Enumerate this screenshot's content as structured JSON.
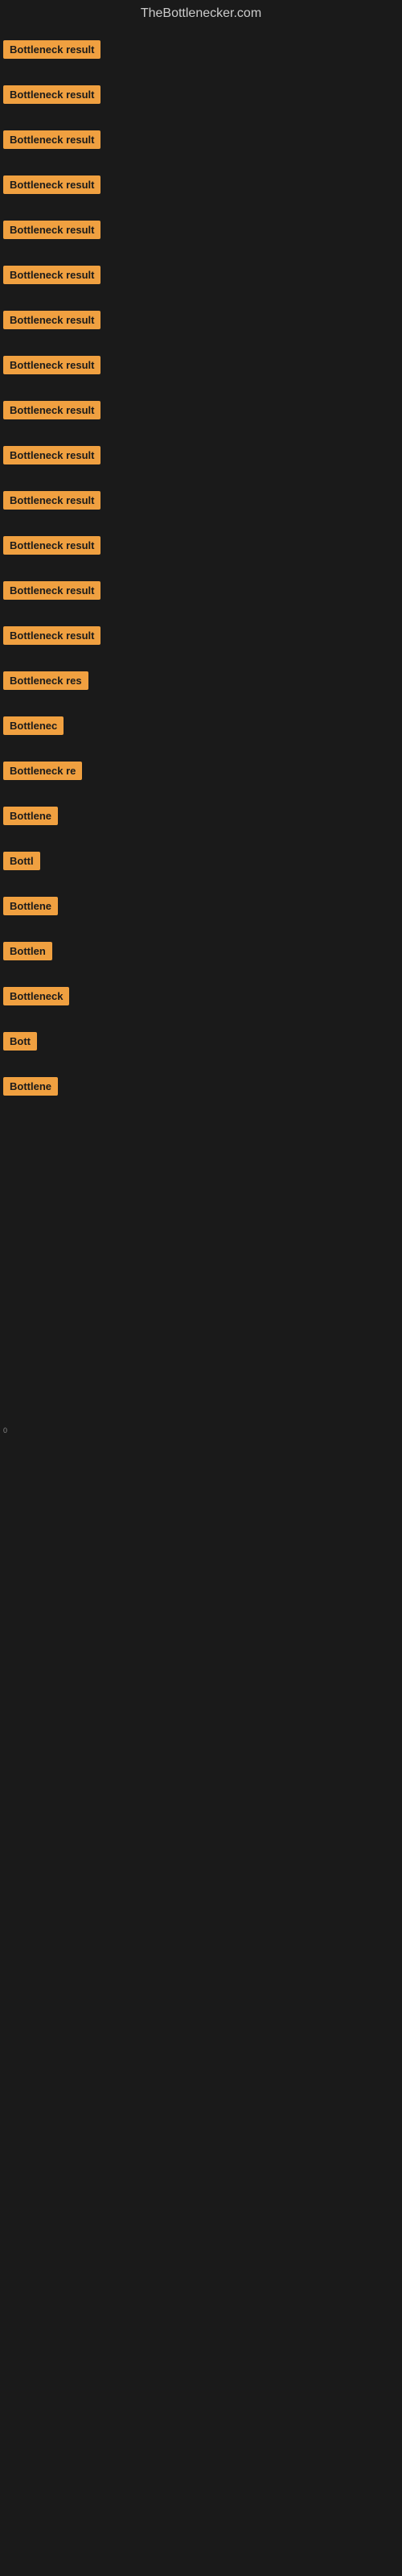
{
  "header": {
    "title": "TheBottlenecker.com"
  },
  "bottleneck_items": [
    {
      "label": "Bottleneck result",
      "size_class": "item-full",
      "row_spacing": 30
    },
    {
      "label": "Bottleneck result",
      "size_class": "item-full",
      "row_spacing": 30
    },
    {
      "label": "Bottleneck result",
      "size_class": "item-full",
      "row_spacing": 30
    },
    {
      "label": "Bottleneck result",
      "size_class": "item-full",
      "row_spacing": 30
    },
    {
      "label": "Bottleneck result",
      "size_class": "item-full",
      "row_spacing": 30
    },
    {
      "label": "Bottleneck result",
      "size_class": "item-full",
      "row_spacing": 30
    },
    {
      "label": "Bottleneck result",
      "size_class": "item-full",
      "row_spacing": 30
    },
    {
      "label": "Bottleneck result",
      "size_class": "item-full",
      "row_spacing": 30
    },
    {
      "label": "Bottleneck result",
      "size_class": "item-full",
      "row_spacing": 30
    },
    {
      "label": "Bottleneck result",
      "size_class": "item-full",
      "row_spacing": 30
    },
    {
      "label": "Bottleneck result",
      "size_class": "item-full",
      "row_spacing": 30
    },
    {
      "label": "Bottleneck result",
      "size_class": "item-full",
      "row_spacing": 30
    },
    {
      "label": "Bottleneck result",
      "size_class": "item-full",
      "row_spacing": 30
    },
    {
      "label": "Bottleneck result",
      "size_class": "item-full",
      "row_spacing": 30
    },
    {
      "label": "Bottleneck res",
      "size_class": "item-w1",
      "row_spacing": 25
    },
    {
      "label": "Bottlenec",
      "size_class": "item-w2",
      "row_spacing": 25
    },
    {
      "label": "Bottleneck re",
      "size_class": "item-w1",
      "row_spacing": 25
    },
    {
      "label": "Bottlene",
      "size_class": "item-w3",
      "row_spacing": 25
    },
    {
      "label": "Bottl",
      "size_class": "item-w4",
      "row_spacing": 25
    },
    {
      "label": "Bottlene",
      "size_class": "item-w3",
      "row_spacing": 25
    },
    {
      "label": "Bottlen",
      "size_class": "item-w4",
      "row_spacing": 25
    },
    {
      "label": "Bottleneck",
      "size_class": "item-w2",
      "row_spacing": 25
    },
    {
      "label": "Bott",
      "size_class": "item-w5",
      "row_spacing": 25
    },
    {
      "label": "Bottlene",
      "size_class": "item-w3",
      "row_spacing": 25
    }
  ],
  "small_label": {
    "text": "0"
  },
  "colors": {
    "badge_bg": "#f0a040",
    "badge_text": "#1a1a1a",
    "background": "#1a1a1a",
    "header_text": "#cccccc"
  }
}
